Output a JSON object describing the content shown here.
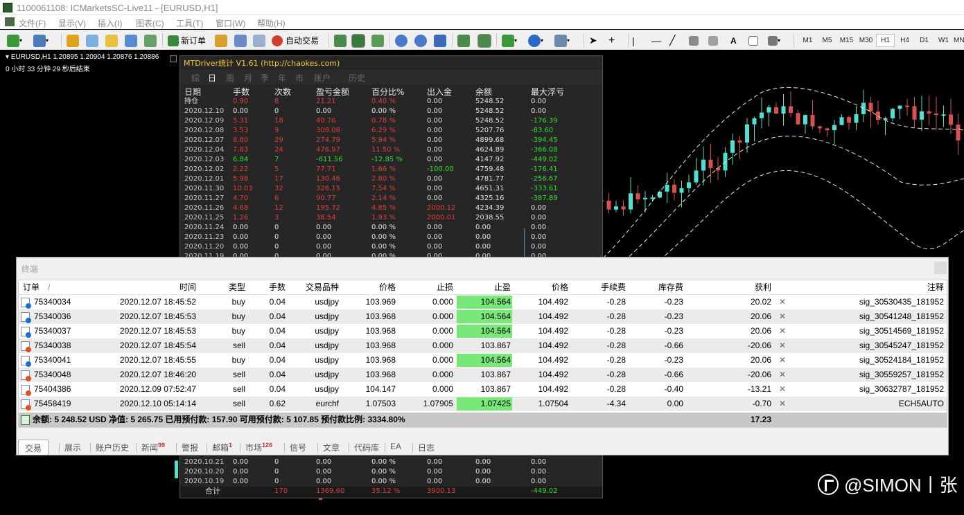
{
  "window": {
    "title": "1100061108: ICMarketsSC-Live11 - [EURUSD,H1]"
  },
  "menu": [
    "文件(F)",
    "显示(V)",
    "插入(I)",
    "图表(C)",
    "工具(T)",
    "窗口(W)",
    "帮助(H)"
  ],
  "toolbar": {
    "new_order": "新订单",
    "auto_trade": "自动交易",
    "text_tool": "A",
    "timeframes": [
      "M1",
      "M5",
      "M15",
      "M30",
      "H1",
      "H4",
      "D1",
      "W1",
      "MN"
    ],
    "active_timeframe": "H1"
  },
  "chart": {
    "symbol_line": "EURUSD,H1  1.20895 1.20904 1.20876 1.20886",
    "countdown": "0 小时 33 分钟 29 秒后结束",
    "bull_color": "#4ee0d0",
    "bear_color": "#d85050",
    "envelope_color": "#f0f0c0"
  },
  "mtdriver": {
    "title": "MTDriver统计 V1.61  (http://chaokes.com)",
    "tabs": [
      "综",
      "日",
      "周",
      "月",
      "季",
      "年",
      "市",
      "账户",
      "历史"
    ],
    "active_tab": "日",
    "headers": [
      "日期",
      "手数",
      "次数",
      "盈亏金额",
      "百分比%",
      "出入金",
      "余额",
      "最大浮亏"
    ],
    "rows": [
      [
        "持仓",
        "0.90",
        "8",
        "21.21",
        "0.40 %",
        "0.00",
        "5248.52",
        "0.00"
      ],
      [
        "2020.12.10",
        "0.00",
        "0",
        "0.00",
        "0.00 %",
        "0.00",
        "5248.52",
        "0.00"
      ],
      [
        "2020.12.09",
        "5.31",
        "18",
        "40.76",
        "0.78 %",
        "0.00",
        "5248.52",
        "-176.39"
      ],
      [
        "2020.12.08",
        "3.53",
        "9",
        "308.08",
        "6.29 %",
        "0.00",
        "5207.76",
        "-83.60"
      ],
      [
        "2020.12.07",
        "8.80",
        "29",
        "274.79",
        "5.94 %",
        "0.00",
        "4899.68",
        "-394.45"
      ],
      [
        "2020.12.04",
        "7.83",
        "24",
        "476.97",
        "11.50 %",
        "0.00",
        "4624.89",
        "-366.08"
      ],
      [
        "2020.12.03",
        "6.84",
        "7",
        "-611.56",
        "-12.85 %",
        "0.00",
        "4147.92",
        "-449.02"
      ],
      [
        "2020.12.02",
        "2.22",
        "5",
        "77.71",
        "1.66 %",
        "-100.00",
        "4759.48",
        "-176.41"
      ],
      [
        "2020.12.01",
        "5.98",
        "17",
        "130.46",
        "2.80 %",
        "0.00",
        "4781.77",
        "-256.67"
      ],
      [
        "2020.11.30",
        "10.03",
        "32",
        "326.15",
        "7.54 %",
        "0.00",
        "4651.31",
        "-333.61"
      ],
      [
        "2020.11.27",
        "4.70",
        "6",
        "90.77",
        "2.14 %",
        "0.00",
        "4325.16",
        "-387.89"
      ],
      [
        "2020.11.26",
        "4.68",
        "12",
        "195.72",
        "4.85 %",
        "2000.12",
        "4234.39",
        "0.00"
      ],
      [
        "2020.11.25",
        "1.26",
        "3",
        "38.54",
        "1.93 %",
        "2000.01",
        "2038.55",
        "0.00"
      ],
      [
        "2020.11.24",
        "0.00",
        "0",
        "0.00",
        "0.00 %",
        "0.00",
        "0.00",
        "0.00"
      ],
      [
        "2020.11.23",
        "0.00",
        "0",
        "0.00",
        "0.00 %",
        "0.00",
        "0.00",
        "0.00"
      ],
      [
        "2020.11.20",
        "0.00",
        "0",
        "0.00",
        "0.00 %",
        "0.00",
        "0.00",
        "0.00"
      ],
      [
        "2020.11.19",
        "0.00",
        "0",
        "0.00",
        "0.00 %",
        "0.00",
        "0.00",
        "0.00"
      ]
    ],
    "row_colors": [
      "red",
      "white",
      "red",
      "red",
      "red",
      "red",
      "green",
      "red",
      "red",
      "red",
      "red",
      "red",
      "red",
      "white",
      "white",
      "white",
      "white"
    ],
    "bottom_rows": [
      [
        "2020.10.21",
        "0.00",
        "0",
        "0.00",
        "0.00 %",
        "0.00",
        "0.00",
        "0.00"
      ],
      [
        "2020.10.20",
        "0.00",
        "0",
        "0.00",
        "0.00 %",
        "0.00",
        "0.00",
        "0.00"
      ],
      [
        "2020.10.19",
        "0.00",
        "0",
        "0.00",
        "0.00 %",
        "0.00",
        "0.00",
        "0.00"
      ]
    ],
    "total": {
      "label": "合计",
      "lots": "",
      "count": "170",
      "pnl": "1369.60",
      "pct": "35.12 %",
      "inout": "3900.13",
      "balance": "",
      "maxdd": "-449.02"
    },
    "colors": {
      "red": "#e23b3b",
      "green": "#33dd33",
      "white": "#e0e0e0"
    }
  },
  "terminal": {
    "title": "终端",
    "headers": [
      "订单",
      "时间",
      "类型",
      "手数",
      "交易品种",
      "价格",
      "止损",
      "止盈",
      "价格",
      "手续费",
      "库存费",
      "获利",
      "注释"
    ],
    "sort_marker": "/",
    "rows": [
      [
        "75340034",
        "2020.12.07 18:45:52",
        "buy",
        "0.04",
        "usdjpy",
        "103.969",
        "0.000",
        "104.564",
        "104.492",
        "-0.28",
        "-0.23",
        "20.02",
        "sig_30530435_181952"
      ],
      [
        "75340036",
        "2020.12.07 18:45:53",
        "buy",
        "0.04",
        "usdjpy",
        "103.968",
        "0.000",
        "104.564",
        "104.492",
        "-0.28",
        "-0.23",
        "20.06",
        "sig_30541248_181952"
      ],
      [
        "75340037",
        "2020.12.07 18:45:53",
        "buy",
        "0.04",
        "usdjpy",
        "103.968",
        "0.000",
        "104.564",
        "104.492",
        "-0.28",
        "-0.23",
        "20.06",
        "sig_30514569_181952"
      ],
      [
        "75340038",
        "2020.12.07 18:45:54",
        "sell",
        "0.04",
        "usdjpy",
        "103.968",
        "0.000",
        "103.867",
        "104.492",
        "-0.28",
        "-0.66",
        "-20.06",
        "sig_30545247_181952"
      ],
      [
        "75340041",
        "2020.12.07 18:45:55",
        "buy",
        "0.04",
        "usdjpy",
        "103.968",
        "0.000",
        "104.564",
        "104.492",
        "-0.28",
        "-0.23",
        "20.06",
        "sig_30524184_181952"
      ],
      [
        "75340048",
        "2020.12.07 18:46:20",
        "sell",
        "0.04",
        "usdjpy",
        "103.968",
        "0.000",
        "103.867",
        "104.492",
        "-0.28",
        "-0.66",
        "-20.06",
        "sig_30559257_181952"
      ],
      [
        "75404386",
        "2020.12.09 07:52:47",
        "sell",
        "0.04",
        "usdjpy",
        "104.147",
        "0.000",
        "103.867",
        "104.492",
        "-0.28",
        "-0.40",
        "-13.21",
        "sig_30632787_181952"
      ],
      [
        "75458419",
        "2020.12.10 05:14:14",
        "sell",
        "0.62",
        "eurchf",
        "1.07503",
        "1.07905",
        "1.07425",
        "1.07504",
        "-4.34",
        "0.00",
        "-0.70",
        "ECH5AUTO"
      ]
    ],
    "tp_highlight": [
      true,
      true,
      true,
      false,
      true,
      false,
      false,
      true
    ],
    "close_glyph": "✕",
    "balance_line": "余额: 5 248.52 USD  净值: 5 265.75  已用预付款: 157.90  可用预付款: 5 107.85  预付款比例: 3334.80%",
    "total_profit": "17.23",
    "tabs": [
      {
        "label": "交易",
        "badge": ""
      },
      {
        "label": "展示",
        "badge": ""
      },
      {
        "label": "账户历史",
        "badge": ""
      },
      {
        "label": "新闻",
        "badge": "99"
      },
      {
        "label": "警报",
        "badge": ""
      },
      {
        "label": "邮箱",
        "badge": "1"
      },
      {
        "label": "市场",
        "badge": "126"
      },
      {
        "label": "信号",
        "badge": ""
      },
      {
        "label": "文章",
        "badge": ""
      },
      {
        "label": "代码库",
        "badge": ""
      },
      {
        "label": "EA",
        "badge": ""
      },
      {
        "label": "日志",
        "badge": ""
      }
    ],
    "active_tab": "交易",
    "tp_color": "#78e878"
  },
  "watermark": {
    "text": "@SIMON丨张"
  }
}
